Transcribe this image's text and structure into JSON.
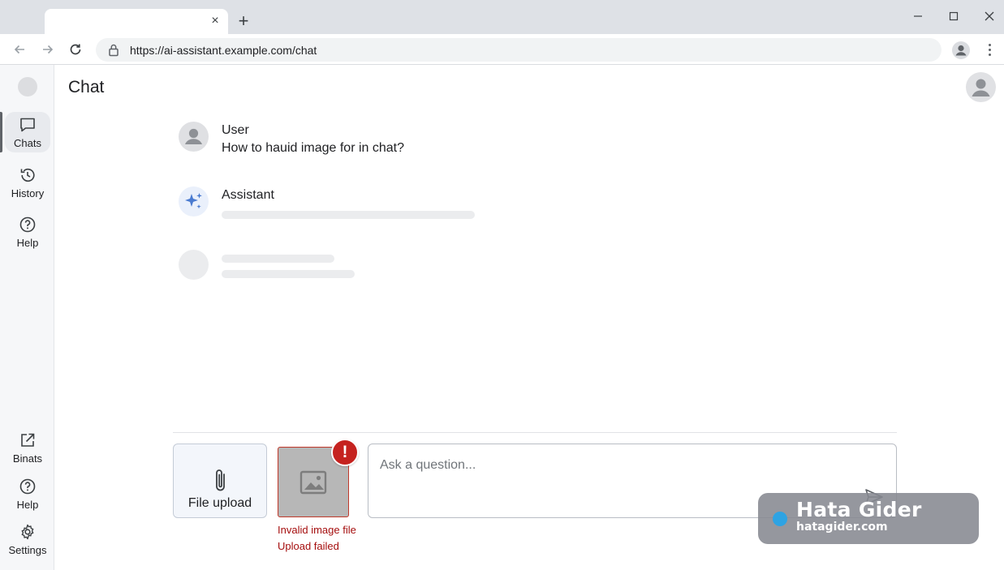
{
  "browser": {
    "tab_close": "×",
    "new_tab": "+",
    "url": "https://ai-assistant.example.com/chat"
  },
  "rail": {
    "items_top": [
      {
        "label": "Chats",
        "icon": "chat-bubble-icon",
        "active": true
      },
      {
        "label": "History",
        "icon": "history-icon"
      },
      {
        "label": "Help",
        "icon": "help-icon"
      }
    ],
    "items_bottom": [
      {
        "label": "Binats",
        "icon": "open-external-icon"
      },
      {
        "label": "Help",
        "icon": "help-icon"
      },
      {
        "label": "Settings",
        "icon": "gear-icon"
      }
    ]
  },
  "main": {
    "title": "Chat",
    "messages": [
      {
        "author": "User",
        "text": "How to hauid image for in chat?",
        "avatar": "person-icon"
      },
      {
        "author": "Assistant",
        "avatar": "sparkle-icon",
        "loading": true
      }
    ]
  },
  "composer": {
    "upload_label": "File upload",
    "upload_icon": "paperclip-icon",
    "thumbnail_icon": "image-icon",
    "error_badge": "!",
    "error_line1": "Invalid image file",
    "error_line2": "Upload failed",
    "input_placeholder": "Ask a question...",
    "input_value": "",
    "send_icon": "send-icon"
  },
  "watermark": {
    "title": "Hata Gider",
    "subtitle": "hatagider.com"
  },
  "colors": {
    "error": "#c5221f",
    "accent": "#4a7bd0",
    "rail_bg": "#f6f7f9"
  }
}
